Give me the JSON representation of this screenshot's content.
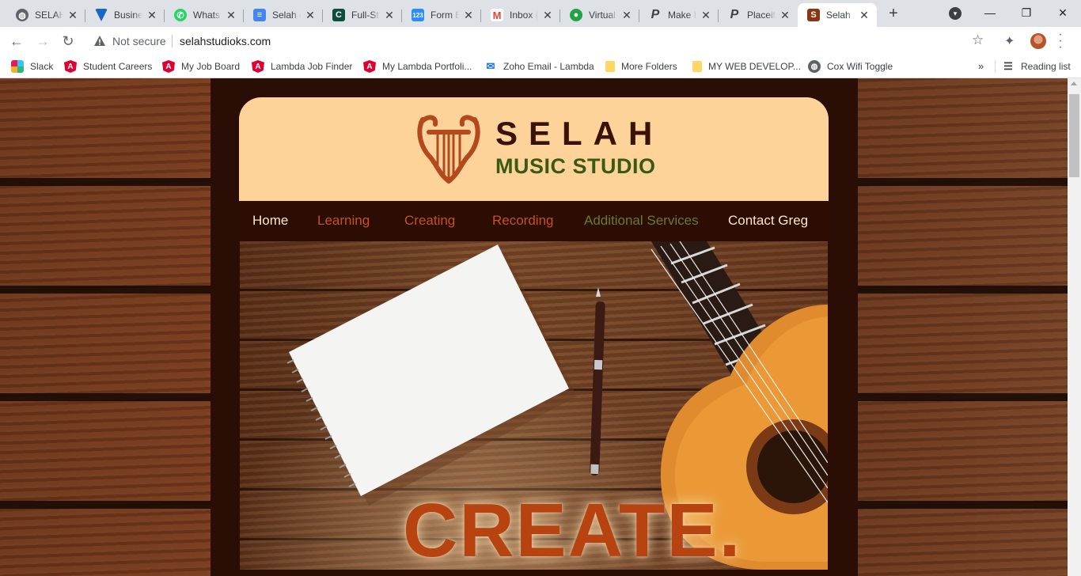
{
  "tabs": [
    {
      "title": "SELAH",
      "icon": "globe-icon",
      "color": "#5f6368"
    },
    {
      "title": "Busine",
      "icon": "vuetify-icon",
      "color": "#1867c0"
    },
    {
      "title": "Whats",
      "icon": "whatsapp-icon",
      "color": "#25d366"
    },
    {
      "title": "Selah (",
      "icon": "google-docs-icon",
      "color": "#4285f4"
    },
    {
      "title": "Full-St",
      "icon": "c-icon",
      "color": "#0f4c3a"
    },
    {
      "title": "Form E",
      "icon": "form-123-icon",
      "color": "#2d8cff"
    },
    {
      "title": "Inbox (",
      "icon": "gmail-icon",
      "color": "#ea4335"
    },
    {
      "title": "Virtual",
      "icon": "microphone-icon",
      "color": "#1ea446"
    },
    {
      "title": "Make I",
      "icon": "p-icon",
      "color": "#3c4043"
    },
    {
      "title": "Placeit",
      "icon": "p-icon",
      "color": "#3c4043"
    },
    {
      "title": "Selah I",
      "icon": "s-icon",
      "color": "#8b3412",
      "active": true
    }
  ],
  "address_bar": {
    "security_label": "Not secure",
    "url": "selahstudioks.com"
  },
  "bookmarks": [
    {
      "label": "Slack",
      "icon": "slack-icon"
    },
    {
      "label": "Student Careers",
      "icon": "angular-icon"
    },
    {
      "label": "My Job Board",
      "icon": "angular-icon"
    },
    {
      "label": "Lambda Job Finder",
      "icon": "angular-icon"
    },
    {
      "label": "My Lambda Portfoli...",
      "icon": "angular-icon"
    },
    {
      "label": "Zoho Email - Lambda",
      "icon": "zoho-icon"
    },
    {
      "label": "More Folders",
      "icon": "folder-icon"
    },
    {
      "label": "MY WEB DEVELOP...",
      "icon": "folder-icon"
    },
    {
      "label": "Cox Wifi Toggle",
      "icon": "globe-icon"
    }
  ],
  "reading_list_label": "Reading list",
  "site": {
    "brand_name": "SELAH",
    "brand_subtitle": "MUSIC STUDIO",
    "nav": [
      {
        "label": "Home",
        "color": "#fde6c6"
      },
      {
        "label": "Learning",
        "color": "#c8501e"
      },
      {
        "label": "Creating",
        "color": "#c8501e"
      },
      {
        "label": "Recording",
        "color": "#c8501e"
      },
      {
        "label": "Additional Services",
        "color": "#6a7a2a"
      },
      {
        "label": "Contact Greg",
        "color": "#fde6c6"
      }
    ],
    "hero_word": "CREATE."
  },
  "colors": {
    "header_bg": "#fed39a",
    "brand_dark": "#3a1208",
    "brand_green": "#3a5a12",
    "accent_orange": "#b64310"
  }
}
